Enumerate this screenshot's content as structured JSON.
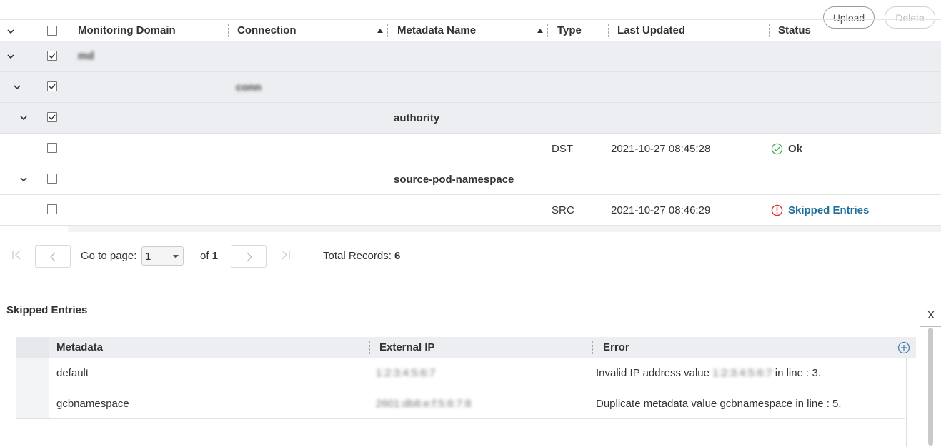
{
  "toolbar": {
    "upload_label": "Upload",
    "delete_label": "Delete"
  },
  "grid": {
    "columns": {
      "monitoring_domain": "Monitoring Domain",
      "connection": "Connection",
      "metadata_name": "Metadata Name",
      "type": "Type",
      "last_updated": "Last Updated",
      "status": "Status"
    },
    "rows": [
      {
        "kind": "group",
        "level": 1,
        "checked": true,
        "label": "md"
      },
      {
        "kind": "group",
        "level": 2,
        "checked": true,
        "label": "conn"
      },
      {
        "kind": "group",
        "level": 3,
        "checked": true,
        "label": "authority"
      },
      {
        "kind": "leaf",
        "checked": false,
        "type": "DST",
        "last_updated": "2021-10-27 08:45:28",
        "status": "Ok"
      },
      {
        "kind": "group",
        "level": 3,
        "checked": false,
        "label": "source-pod-namespace"
      },
      {
        "kind": "leaf",
        "checked": false,
        "type": "SRC",
        "last_updated": "2021-10-27 08:46:29",
        "status": "Skipped Entries"
      }
    ]
  },
  "pagination": {
    "go_to_page_label": "Go to page:",
    "page_value": "1",
    "of_label": "of",
    "total_pages": "1",
    "total_records_label": "Total Records:",
    "total_records": "6"
  },
  "skipped_panel": {
    "title": "Skipped Entries",
    "close_label": "X",
    "columns": {
      "metadata": "Metadata",
      "external_ip": "External IP",
      "error": "Error"
    },
    "rows": [
      {
        "metadata": "default",
        "external_ip": "1:2:3:4:5:6:7",
        "error_prefix": "Invalid IP address value",
        "error_value": "1:2:3:4:5:6:7",
        "error_suffix": "in line : 3."
      },
      {
        "metadata": "gcbnamespace",
        "external_ip": "2601:db8:e:f:5:6:7:8",
        "error_full": "Duplicate metadata value gcbnamespace in line : 5."
      }
    ]
  },
  "colors": {
    "accent": "#1d6f9a",
    "ok": "#3aa84a",
    "error": "#d9352d",
    "group_bg": "#eceef1"
  }
}
